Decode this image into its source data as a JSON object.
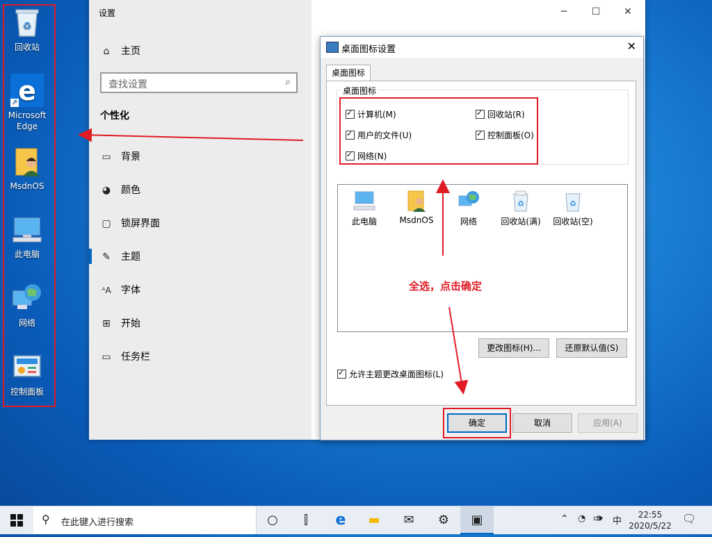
{
  "desktop": {
    "icons": [
      {
        "label": "回收站"
      },
      {
        "label": "Microsoft Edge"
      },
      {
        "label": "MsdnOS"
      },
      {
        "label": "此电脑"
      },
      {
        "label": "网络"
      },
      {
        "label": "控制面板"
      }
    ]
  },
  "settings": {
    "title": "设置",
    "home": "主页",
    "search_placeholder": "查找设置",
    "section": "个性化",
    "nav": [
      {
        "label": "背景",
        "icon": "picture-icon"
      },
      {
        "label": "颜色",
        "icon": "palette-icon"
      },
      {
        "label": "锁屏界面",
        "icon": "lockscreen-icon"
      },
      {
        "label": "主题",
        "icon": "brush-icon"
      },
      {
        "label": "字体",
        "icon": "font-icon"
      },
      {
        "label": "开始",
        "icon": "start-tiles-icon"
      },
      {
        "label": "任务栏",
        "icon": "taskbar-icon"
      }
    ],
    "active": "主题"
  },
  "dialog": {
    "title": "桌面图标设置",
    "tab": "桌面图标",
    "group_label": "桌面图标",
    "checkboxes": [
      {
        "label": "计算机(M)",
        "checked": true
      },
      {
        "label": "回收站(R)",
        "checked": true
      },
      {
        "label": "用户的文件(U)",
        "checked": true
      },
      {
        "label": "控制面板(O)",
        "checked": true
      },
      {
        "label": "网络(N)",
        "checked": true
      }
    ],
    "preview_icons": [
      {
        "label": "此电脑"
      },
      {
        "label": "MsdnOS"
      },
      {
        "label": "网络"
      },
      {
        "label": "回收站(满)"
      },
      {
        "label": "回收站(空)"
      }
    ],
    "change_icon_button": "更改图标(H)...",
    "restore_default_button": "还原默认值(S)",
    "allow_themes_label": "允许主题更改桌面图标(L)",
    "allow_themes_checked": true,
    "ok_button": "确定",
    "cancel_button": "取消",
    "apply_button": "应用(A)"
  },
  "annotation": {
    "text": "全选，点击确定",
    "color": "#e01b24"
  },
  "taskbar": {
    "search_placeholder": "在此键入进行搜索",
    "ime": "中",
    "time": "22:55",
    "date": "2020/5/22"
  }
}
